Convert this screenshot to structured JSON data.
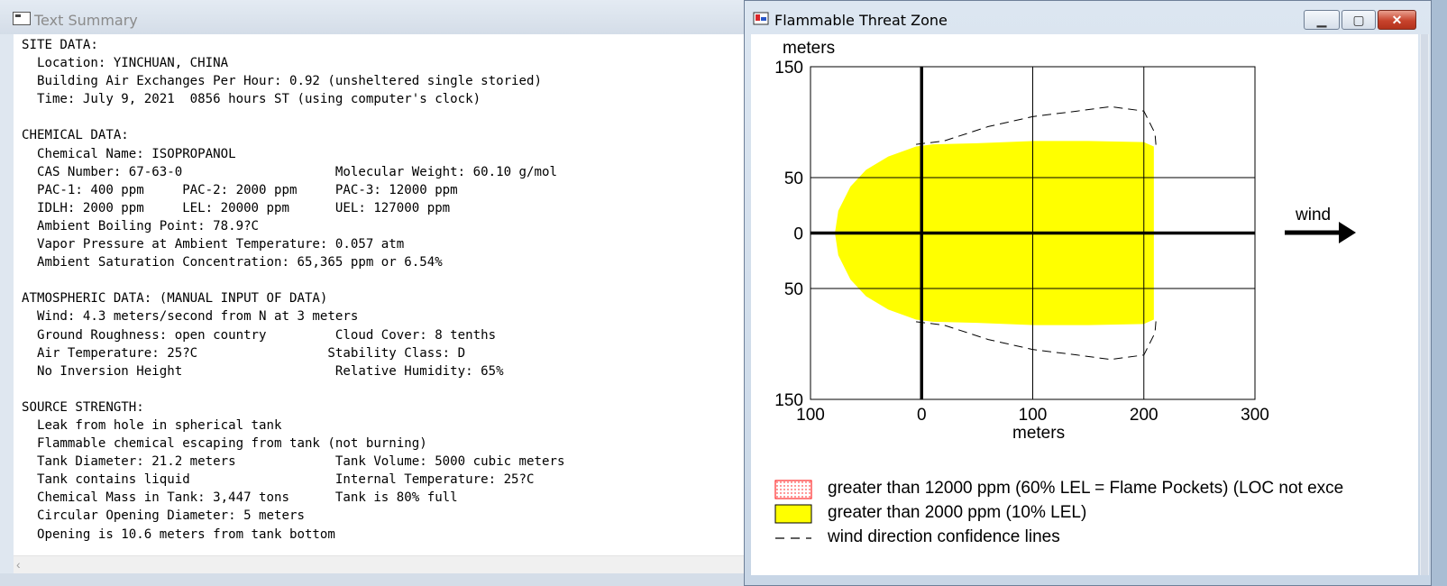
{
  "text_window": {
    "title": "Text Summary",
    "lines": [
      "SITE DATA:",
      "  Location: YINCHUAN, CHINA",
      "  Building Air Exchanges Per Hour: 0.92 (unsheltered single storied)",
      "  Time: July 9, 2021  0856 hours ST (using computer's clock)",
      "",
      "CHEMICAL DATA:",
      "  Chemical Name: ISOPROPANOL",
      "  CAS Number: 67-63-0                    Molecular Weight: 60.10 g/mol",
      "  PAC-1: 400 ppm     PAC-2: 2000 ppm     PAC-3: 12000 ppm",
      "  IDLH: 2000 ppm     LEL: 20000 ppm      UEL: 127000 ppm",
      "  Ambient Boiling Point: 78.9?C",
      "  Vapor Pressure at Ambient Temperature: 0.057 atm",
      "  Ambient Saturation Concentration: 65,365 ppm or 6.54%",
      "",
      "ATMOSPHERIC DATA: (MANUAL INPUT OF DATA)",
      "  Wind: 4.3 meters/second from N at 3 meters",
      "  Ground Roughness: open country         Cloud Cover: 8 tenths",
      "  Air Temperature: 25?C                 Stability Class: D",
      "  No Inversion Height                    Relative Humidity: 65%",
      "",
      "SOURCE STRENGTH:",
      "  Leak from hole in spherical tank",
      "  Flammable chemical escaping from tank (not burning)",
      "  Tank Diameter: 21.2 meters             Tank Volume: 5000 cubic meters",
      "  Tank contains liquid                   Internal Temperature: 25?C",
      "  Chemical Mass in Tank: 3,447 tons      Tank is 80% full",
      "  Circular Opening Diameter: 5 meters",
      "  Opening is 10.6 meters from tank bottom"
    ]
  },
  "plot_window": {
    "title": "Flammable Threat Zone",
    "controls": {
      "minimize": "minimize",
      "maximize": "maximize",
      "close": "close"
    },
    "wind_label": "wind",
    "legend": [
      {
        "label": "greater than 12000 ppm (60% LEL = Flame Pockets) (LOC not exce",
        "swatch": "red-dotted",
        "color": "#ff0000"
      },
      {
        "label": "greater than 2000 ppm (10% LEL)",
        "swatch": "yellow-fill",
        "color": "#ffff00"
      },
      {
        "label": "wind direction confidence lines",
        "swatch": "dashed-line",
        "color": "#000000"
      }
    ]
  },
  "chart_data": {
    "type": "area",
    "x_axis": {
      "label": "meters",
      "ticks": [
        "100",
        "0",
        "100",
        "200",
        "300"
      ],
      "tick_values": [
        -100,
        0,
        100,
        200,
        300
      ],
      "range": [
        -100,
        300
      ]
    },
    "y_axis": {
      "label": "meters",
      "ticks": [
        "150",
        "50",
        "0",
        "50",
        "150"
      ],
      "tick_values": [
        150,
        50,
        0,
        -50,
        -150
      ],
      "range": [
        -150,
        150
      ]
    },
    "grid": true,
    "threat_zone_2000ppm": {
      "color": "#ffff00",
      "outline": [
        [
          -78,
          0
        ],
        [
          -75,
          20
        ],
        [
          -64,
          42
        ],
        [
          -50,
          57
        ],
        [
          -30,
          69
        ],
        [
          -5,
          78
        ],
        [
          10,
          80
        ],
        [
          50,
          81
        ],
        [
          100,
          83
        ],
        [
          150,
          83
        ],
        [
          200,
          82
        ],
        [
          209,
          78
        ],
        [
          209,
          -78
        ],
        [
          200,
          -82
        ],
        [
          150,
          -83
        ],
        [
          100,
          -83
        ],
        [
          50,
          -81
        ],
        [
          10,
          -80
        ],
        [
          -5,
          -78
        ],
        [
          -30,
          -69
        ],
        [
          -50,
          -57
        ],
        [
          -64,
          -42
        ],
        [
          -75,
          -20
        ],
        [
          -78,
          0
        ]
      ]
    },
    "confidence_lines": [
      {
        "points": [
          [
            -5,
            80
          ],
          [
            20,
            83
          ],
          [
            60,
            96
          ],
          [
            100,
            105
          ],
          [
            140,
            110
          ],
          [
            170,
            114
          ],
          [
            200,
            110
          ],
          [
            210,
            90
          ],
          [
            211,
            78
          ]
        ]
      },
      {
        "points": [
          [
            -5,
            -80
          ],
          [
            20,
            -83
          ],
          [
            60,
            -96
          ],
          [
            100,
            -105
          ],
          [
            140,
            -110
          ],
          [
            170,
            -114
          ],
          [
            200,
            -110
          ],
          [
            210,
            -90
          ],
          [
            211,
            -78
          ]
        ]
      }
    ]
  }
}
